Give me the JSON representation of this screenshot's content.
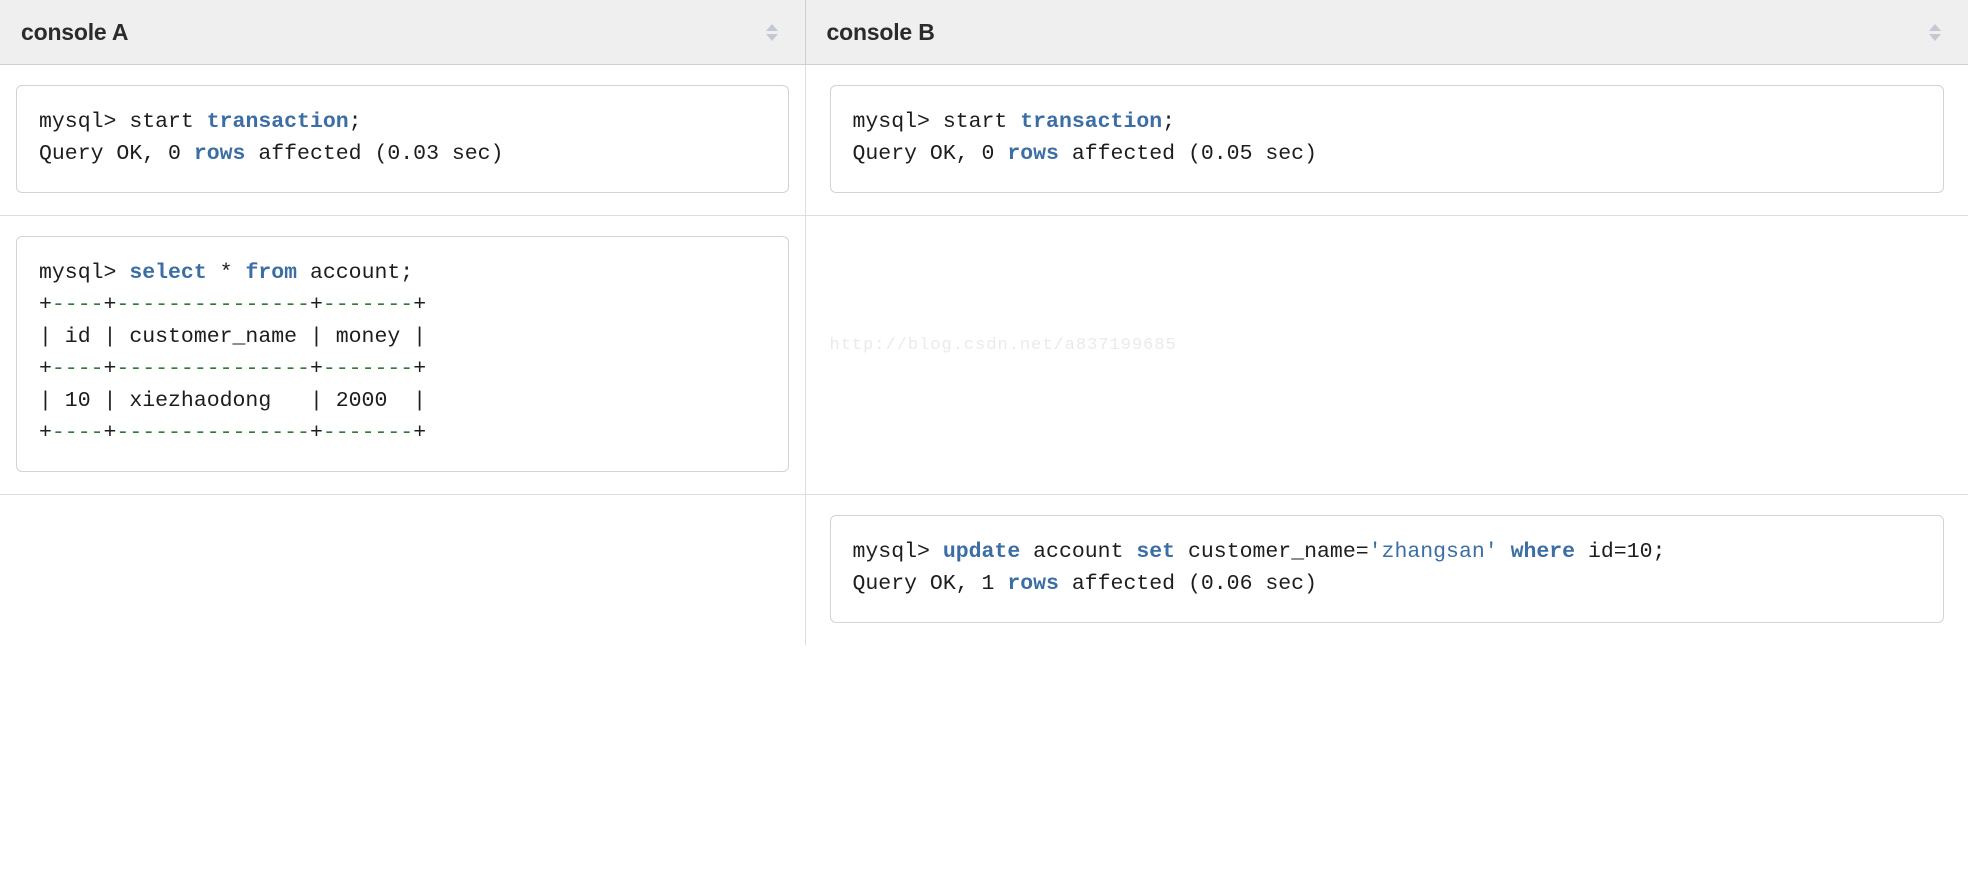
{
  "columns": [
    {
      "title": "console A",
      "sort_icon": "sort-updown-icon"
    },
    {
      "title": "console B",
      "sort_icon": "sort-updown-icon"
    }
  ],
  "theme": {
    "keyword_color": "#3b6ea5",
    "ascii_border_color": "#2f7d32",
    "text_color": "#1d1d1d",
    "header_bg": "#efefef",
    "box_border": "#d3d3d3",
    "watermark_color": "#eaeaea"
  },
  "watermark": {
    "text": "http://blog.csdn.net/a837199685"
  },
  "rows": [
    {
      "console_a": {
        "has_box": true,
        "lines": [
          [
            {
              "t": "mysql> start ",
              "c": "plain"
            },
            {
              "t": "transaction",
              "c": "kw"
            },
            {
              "t": ";",
              "c": "plain"
            }
          ],
          [
            {
              "t": "Query OK, 0 ",
              "c": "plain"
            },
            {
              "t": "rows",
              "c": "kw"
            },
            {
              "t": " affected (0.03 sec)",
              "c": "plain"
            }
          ]
        ]
      },
      "console_b": {
        "has_box": true,
        "lines": [
          [
            {
              "t": "mysql> start ",
              "c": "plain"
            },
            {
              "t": "transaction",
              "c": "kw"
            },
            {
              "t": ";",
              "c": "plain"
            }
          ],
          [
            {
              "t": "Query OK, 0 ",
              "c": "plain"
            },
            {
              "t": "rows",
              "c": "kw"
            },
            {
              "t": " affected (0.05 sec)",
              "c": "plain"
            }
          ]
        ]
      }
    },
    {
      "console_a": {
        "has_box": true,
        "lines": [
          [
            {
              "t": "mysql> ",
              "c": "plain"
            },
            {
              "t": "select",
              "c": "kw"
            },
            {
              "t": " * ",
              "c": "plain"
            },
            {
              "t": "from",
              "c": "kw"
            },
            {
              "t": " account;",
              "c": "plain"
            }
          ],
          [
            {
              "t": "+",
              "c": "plain"
            },
            {
              "t": "----",
              "c": "dash"
            },
            {
              "t": "+",
              "c": "plain"
            },
            {
              "t": "---------------",
              "c": "dash"
            },
            {
              "t": "+",
              "c": "plain"
            },
            {
              "t": "-------",
              "c": "dash"
            },
            {
              "t": "+",
              "c": "plain"
            }
          ],
          [
            {
              "t": "| id | customer_name | money |",
              "c": "plain"
            }
          ],
          [
            {
              "t": "+",
              "c": "plain"
            },
            {
              "t": "----",
              "c": "dash"
            },
            {
              "t": "+",
              "c": "plain"
            },
            {
              "t": "---------------",
              "c": "dash"
            },
            {
              "t": "+",
              "c": "plain"
            },
            {
              "t": "-------",
              "c": "dash"
            },
            {
              "t": "+",
              "c": "plain"
            }
          ],
          [
            {
              "t": "| 10 | xiezhaodong   | 2000  |",
              "c": "plain"
            }
          ],
          [
            {
              "t": "+",
              "c": "plain"
            },
            {
              "t": "----",
              "c": "dash"
            },
            {
              "t": "+",
              "c": "plain"
            },
            {
              "t": "---------------",
              "c": "dash"
            },
            {
              "t": "+",
              "c": "plain"
            },
            {
              "t": "-------",
              "c": "dash"
            },
            {
              "t": "+",
              "c": "plain"
            }
          ]
        ]
      },
      "console_b": {
        "has_box": false,
        "lines": []
      }
    },
    {
      "console_a": {
        "has_box": false,
        "lines": []
      },
      "console_b": {
        "has_box": true,
        "lines": [
          [
            {
              "t": "mysql> ",
              "c": "plain"
            },
            {
              "t": "update",
              "c": "kw"
            },
            {
              "t": " account ",
              "c": "plain"
            },
            {
              "t": "set",
              "c": "kw"
            },
            {
              "t": " customer_name=",
              "c": "plain"
            },
            {
              "t": "'zhangsan'",
              "c": "str"
            },
            {
              "t": " ",
              "c": "plain"
            },
            {
              "t": "where",
              "c": "kw"
            },
            {
              "t": " id=10;",
              "c": "plain"
            }
          ],
          [
            {
              "t": "Query OK, 1 ",
              "c": "plain"
            },
            {
              "t": "rows",
              "c": "kw"
            },
            {
              "t": " affected (0.06 sec)",
              "c": "plain"
            }
          ]
        ]
      }
    }
  ]
}
